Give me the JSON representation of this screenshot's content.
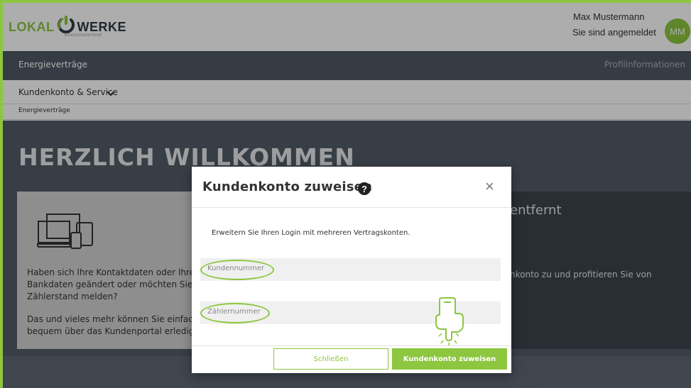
{
  "brand": {
    "logo_part_a": "LOKAL",
    "logo_part_b": "WERKE",
    "logo_sub": "Westmünsterland",
    "accent": "#8dc63f",
    "dark": "#4e5964"
  },
  "user": {
    "name": "Max Mustermann",
    "status": "Sie sind angemeldet",
    "initials": "MM"
  },
  "nav": {
    "left": "Energieverträge",
    "right": "Profilinformationen"
  },
  "subnav": {
    "label": "Kundenkonto & Service",
    "chevron": "⌄"
  },
  "breadcrumb": "Energieverträge",
  "hero": {
    "title": "HERZLICH WILLKOMMEN",
    "card_left": {
      "icon": "devices-icon",
      "text_1": "Haben sich Ihre Kontaktdaten oder Ihre Bankdaten geändert oder möchten Sie Ihren Zählerstand melden?",
      "text_2": "Das und vieles mehr können Sie einfach und bequem über das Kundenportal erledigen."
    },
    "card_right": {
      "title": "entfernt",
      "text": "nkonto zu und profitieren Sie von"
    }
  },
  "modal": {
    "title": "Kundenkonto zuweisen",
    "help_glyph": "?",
    "close_glyph": "×",
    "description": "Erweitern Sie Ihren Login mit mehreren Vertragskonten.",
    "fields": {
      "kundennummer_placeholder": "Kundennummer",
      "zaehlernummer_placeholder": "Zählernummer"
    },
    "buttons": {
      "close": "Schließen",
      "assign": "Kundenkonto zuweisen"
    }
  }
}
